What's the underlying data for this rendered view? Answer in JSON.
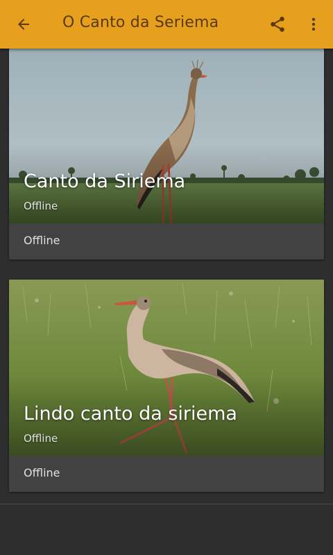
{
  "app": {
    "title": "O Canto da Seriema",
    "accent_color": "#e6a01d",
    "background_color": "#2e2e2e"
  },
  "toolbar": {
    "back_icon": "arrow-left-icon",
    "share_icon": "share-icon",
    "more_icon": "more-vert-icon"
  },
  "cards": [
    {
      "title": "Canto da Siriema",
      "subtitle": "Offline",
      "footer": "Offline",
      "image": "seriema-standing-in-field-photo"
    },
    {
      "title": "Lindo canto da siriema",
      "subtitle": "Offline",
      "footer": "Offline",
      "image": "seriema-walking-on-grass-photo"
    }
  ]
}
